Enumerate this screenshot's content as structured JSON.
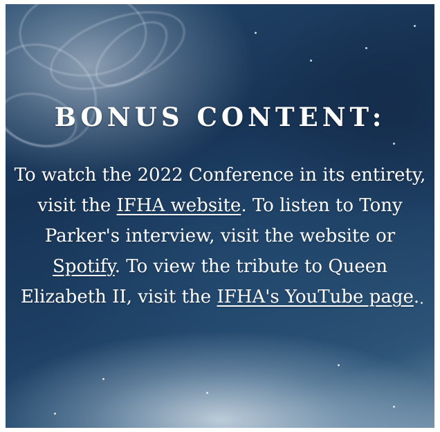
{
  "heading": "BONUS CONTENT:",
  "paragraph": {
    "t1": "To watch the 2022 Conference in its entirety, visit the ",
    "link1": "IFHA website",
    "t2": ". To listen to Tony Parker's interview, visit the website or ",
    "link2": "Spotify",
    "t3": ". To view the tribute to Queen Elizabeth II, visit the ",
    "link3": "IFHA's YouTube page",
    "t4": "."
  },
  "colors": {
    "background_dark": "#173456",
    "background_mid": "#24476a",
    "text": "#ffffff"
  }
}
